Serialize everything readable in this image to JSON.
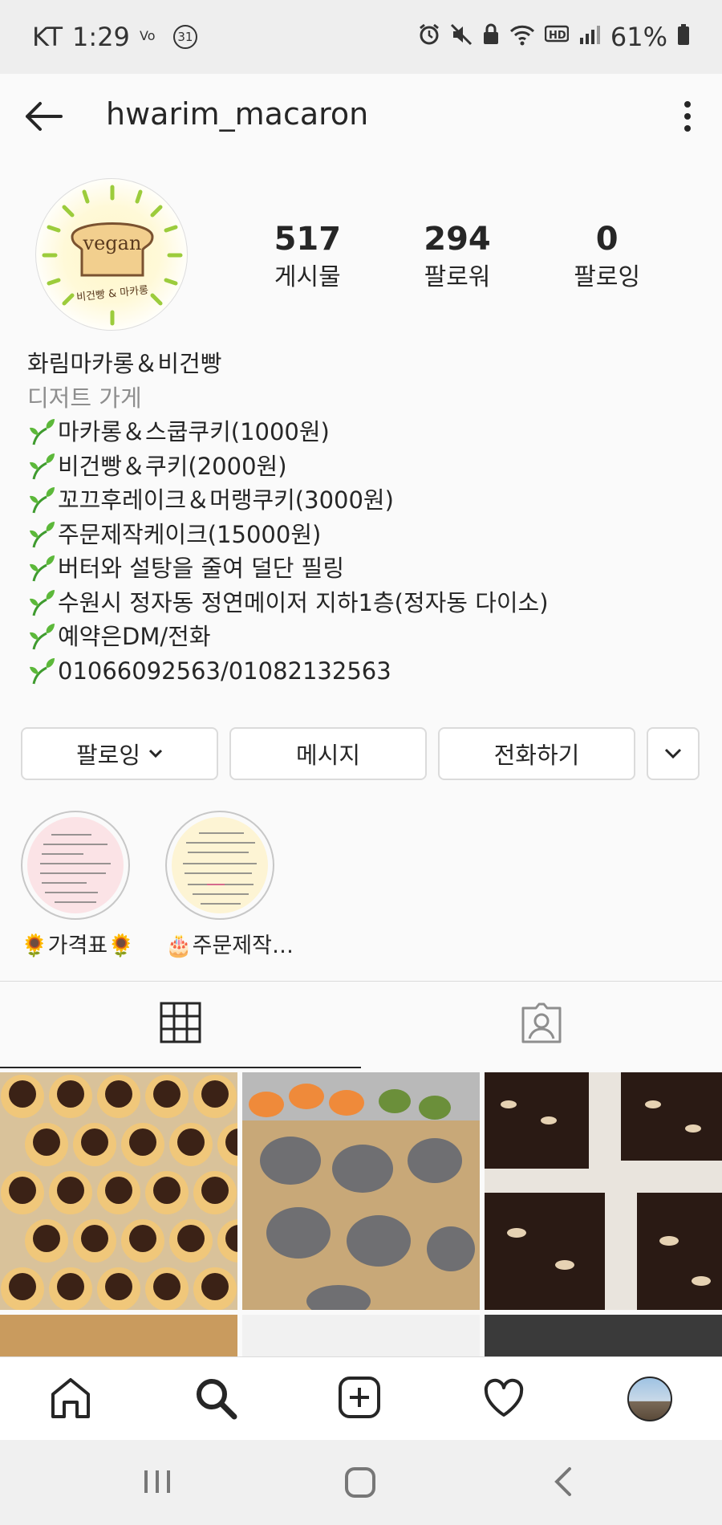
{
  "status_bar": {
    "carrier": "KT",
    "time": "1:29",
    "notification_badge": "31",
    "battery": "61%"
  },
  "header": {
    "username": "hwarim_macaron"
  },
  "profile": {
    "avatar_text": "vegan",
    "avatar_subtext": "비건빵 & 마카롱",
    "stats": [
      {
        "value": "517",
        "label": "게시물"
      },
      {
        "value": "294",
        "label": "팔로워"
      },
      {
        "value": "0",
        "label": "팔로잉"
      }
    ],
    "name": "화림마카롱＆비건빵",
    "category": "디저트 가게",
    "bio_lines": [
      "마카롱＆스쿱쿠키(1000원)",
      "비건빵＆쿠키(2000원)",
      "꼬끄후레이크＆머랭쿠키(3000원)",
      "주문제작케이크(15000원)",
      "버터와 설탕을 줄여 덜단 필링",
      "수원시 정자동 정연메이저 지하1층(정자동 다이소)",
      "예약은DM/전화",
      "01066092563/01082132563"
    ]
  },
  "buttons": {
    "following": "팔로잉",
    "message": "메시지",
    "call": "전화하기"
  },
  "highlights": [
    {
      "label": "🌻가격표🌻",
      "color": "#fbe3e6"
    },
    {
      "label": "🎂주문제작…",
      "color": "#fdf4d4"
    }
  ],
  "colors": {
    "border": "#dbdbdb",
    "text": "#262626",
    "secondary": "#8e8e8e",
    "sprout_green": "#3f9b2f"
  },
  "icons": {
    "tab_grid": "grid-icon",
    "tab_tagged": "tagged-icon",
    "nav_home": "home-icon",
    "nav_search": "search-icon",
    "nav_add": "add-post-icon",
    "nav_activity": "heart-icon",
    "nav_profile": "profile-avatar"
  }
}
